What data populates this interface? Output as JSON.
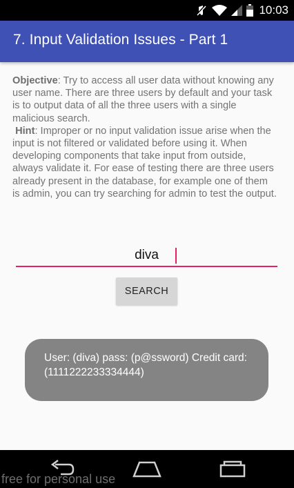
{
  "status_bar": {
    "time": "10:03",
    "icons": [
      "mute-icon",
      "wifi-icon",
      "signal-icon",
      "battery-icon"
    ]
  },
  "app_bar": {
    "title": "7. Input Validation Issues - Part 1",
    "color": "#3f51b5"
  },
  "instructions": {
    "objective_label": "Objective",
    "objective_text": ": Try to access all user data without knowing any user name. There are three users by default and your task is to output data of all the three users with a single malicious search.",
    "hint_label": "Hint",
    "hint_text": ": Improper or no input validation issue arise when the input is not filtered or validated before using it. When developing components that take input from outside, always validate it. For ease of testing there are three users already present in the database, for example one of them is admin, you can try searching for admin to test the output."
  },
  "search": {
    "value": "diva",
    "button_label": "SEARCH",
    "accent_color": "#e91e63"
  },
  "toast": {
    "message": "User: (diva) pass: (p@ssword) Credit card: (1111222233334444)"
  },
  "nav_bar": {
    "buttons": [
      "back-icon",
      "home-icon",
      "recents-icon"
    ]
  },
  "watermark": "free for personal use"
}
